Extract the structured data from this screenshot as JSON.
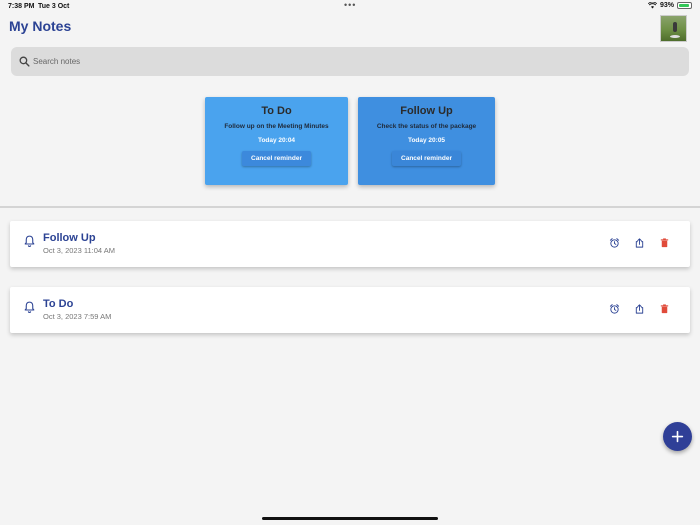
{
  "status_bar": {
    "time": "7:38 PM",
    "date": "Tue 3 Oct",
    "dots": "•••",
    "battery": "93%",
    "battery_level": 0.93
  },
  "header": {
    "title": "My Notes"
  },
  "search": {
    "placeholder": "Search notes",
    "value": ""
  },
  "reminders": [
    {
      "title": "To Do",
      "description": "Follow up on the Meeting Minutes",
      "time": "Today  20:04",
      "button_label": "Cancel reminder"
    },
    {
      "title": "Follow Up",
      "description": "Check the status of the package",
      "time": "Today  20:05",
      "button_label": "Cancel reminder"
    }
  ],
  "notes": [
    {
      "title": "Follow Up",
      "date": "Oct 3, 2023 11:04 AM"
    },
    {
      "title": "To Do",
      "date": "Oct 3, 2023 7:59 AM"
    }
  ],
  "colors": {
    "accent": "#2c4394",
    "card_blue": "#4aa3ee",
    "delete_red": "#e04b3a",
    "fab": "#2f3f97"
  },
  "icons": [
    "search-icon",
    "bell-icon",
    "alarm-icon",
    "share-icon",
    "trash-icon",
    "plus-icon",
    "wifi-icon",
    "battery-icon"
  ]
}
